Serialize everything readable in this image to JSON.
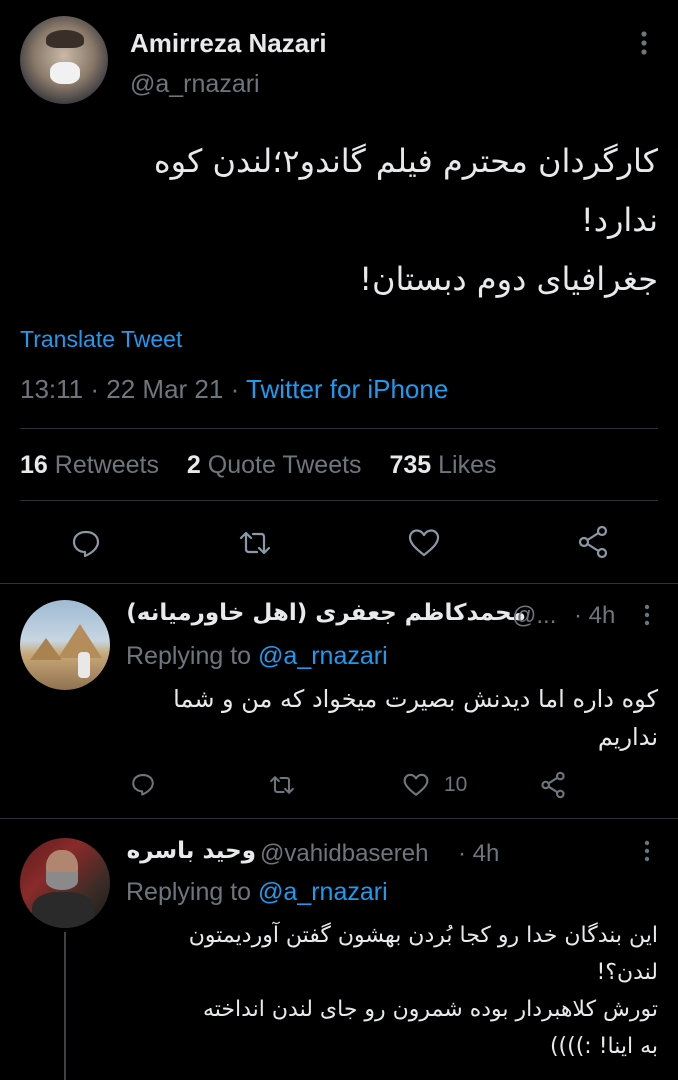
{
  "tweet": {
    "author_name": "Amirreza Nazari",
    "author_handle": "@a_rnazari",
    "text_lines": [
      "کارگردان محترم فیلم گاندو۲؛لندن کوه",
      "ندارد!",
      "جغرافیای دوم دبستان!"
    ],
    "translate_label": "Translate Tweet",
    "time": "13:11",
    "date": "22 Mar 21",
    "source": "Twitter for iPhone",
    "retweets_count": "16",
    "retweets_label": "Retweets",
    "quotes_count": "2",
    "quotes_label": "Quote Tweets",
    "likes_count": "735",
    "likes_label": "Likes"
  },
  "replies": [
    {
      "name": "محمدکاظم جعفری (اهل خاورمیانه)",
      "handle": "@...",
      "age": "4h",
      "replying_prefix": "Replying to",
      "replying_handle": "@a_rnazari",
      "text_lines": [
        "کوه داره اما دیدنش بصیرت میخواد که من و شما",
        "نداریم"
      ],
      "likes": "10"
    },
    {
      "name": "وحید باسره",
      "handle": "@vahidbasereh",
      "age": "4h",
      "replying_prefix": "Replying to",
      "replying_handle": "@a_rnazari",
      "text_lines": [
        "این بندگان خدا رو کجا بُردن بهشون گفتن آوردیمتون",
        "لندن؟!",
        "تورش کلاهبردار بوده شمرون رو جای لندن انداخته",
        "به اینا! :))))"
      ]
    }
  ],
  "colors": {
    "background": "#000000",
    "text": "#d9d9d9",
    "muted": "#6e767d",
    "link": "#1d9bf0",
    "divider": "#2f3336"
  }
}
